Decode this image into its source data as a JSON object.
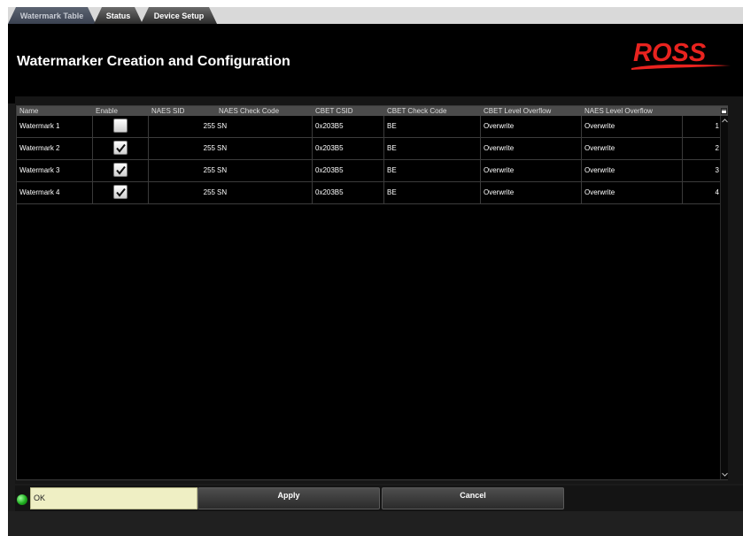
{
  "tabs": [
    {
      "label": "Watermark Table",
      "active": true
    },
    {
      "label": "Status",
      "active": false
    },
    {
      "label": "Device Setup",
      "active": false
    }
  ],
  "header": {
    "title": "Watermarker Creation and Configuration",
    "logo_text": "ROSS",
    "logo_color": "#e8231f"
  },
  "table": {
    "columns": [
      "Name",
      "Enable",
      "NAES SID",
      "NAES Check Code",
      "CBET CSID",
      "CBET Check Code",
      "CBET Level Overflow",
      "NAES Level Overflow"
    ],
    "rows": [
      {
        "name": "Watermark 1",
        "enabled": false,
        "naes_sid": "255",
        "naes_check_code": "SN",
        "cbet_csid": "0x203B5",
        "cbet_check_code": "BE",
        "cbet_level_overflow": "Overwrite",
        "naes_level_overflow": "Overwrite",
        "index": "1"
      },
      {
        "name": "Watermark 2",
        "enabled": true,
        "naes_sid": "255",
        "naes_check_code": "SN",
        "cbet_csid": "0x203B5",
        "cbet_check_code": "BE",
        "cbet_level_overflow": "Overwrite",
        "naes_level_overflow": "Overwrite",
        "index": "2"
      },
      {
        "name": "Watermark 3",
        "enabled": true,
        "naes_sid": "255",
        "naes_check_code": "SN",
        "cbet_csid": "0x203B5",
        "cbet_check_code": "BE",
        "cbet_level_overflow": "Overwrite",
        "naes_level_overflow": "Overwrite",
        "index": "3"
      },
      {
        "name": "Watermark 4",
        "enabled": true,
        "naes_sid": "255",
        "naes_check_code": "SN",
        "cbet_csid": "0x203B5",
        "cbet_check_code": "BE",
        "cbet_level_overflow": "Overwrite",
        "naes_level_overflow": "Overwrite",
        "index": "4"
      }
    ]
  },
  "status": {
    "text": "OK",
    "led_color": "#1fae1f"
  },
  "buttons": {
    "apply": "Apply",
    "cancel": "Cancel"
  },
  "icons": {
    "column_chooser": "column-chooser-icon",
    "scroll_up": "chevron-up-icon",
    "scroll_down": "chevron-down-icon"
  }
}
